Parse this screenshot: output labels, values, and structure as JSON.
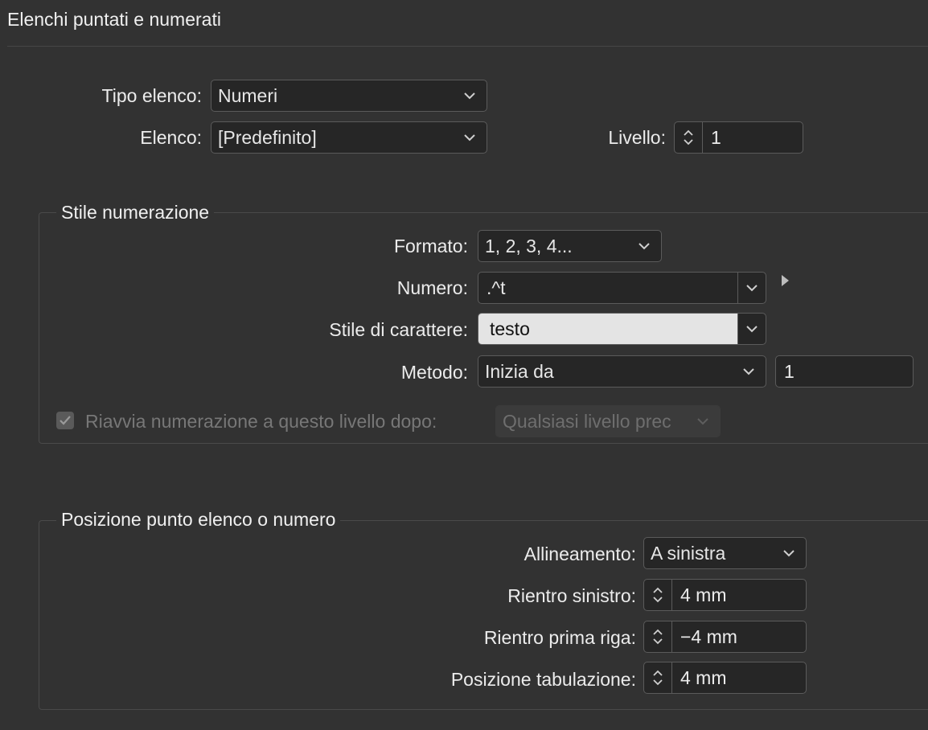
{
  "dialog": {
    "title": "Elenchi puntati e numerati"
  },
  "list": {
    "type_label": "Tipo elenco:",
    "type_value": "Numeri",
    "list_label": "Elenco:",
    "list_value": "[Predefinito]",
    "level_label": "Livello:",
    "level_value": "1"
  },
  "numbering_style": {
    "legend": "Stile numerazione",
    "format_label": "Formato:",
    "format_value": "1, 2, 3, 4...",
    "number_label": "Numero:",
    "number_value": ".^t",
    "char_style_label": "Stile di carattere:",
    "char_style_value": "testo",
    "mode_label": "Metodo:",
    "mode_value": "Inizia da",
    "start_value": "1",
    "restart_label": "Riavvia numerazione a questo livello dopo:",
    "restart_checked": true,
    "restart_value": "Qualsiasi livello prec"
  },
  "position": {
    "legend": "Posizione punto elenco o numero",
    "alignment_label": "Allineamento:",
    "alignment_value": "A sinistra",
    "left_indent_label": "Rientro sinistro:",
    "left_indent_value": "4 mm",
    "first_line_label": "Rientro prima riga:",
    "first_line_value": "−4 mm",
    "tab_position_label": "Posizione tabulazione:",
    "tab_position_value": "4 mm"
  }
}
